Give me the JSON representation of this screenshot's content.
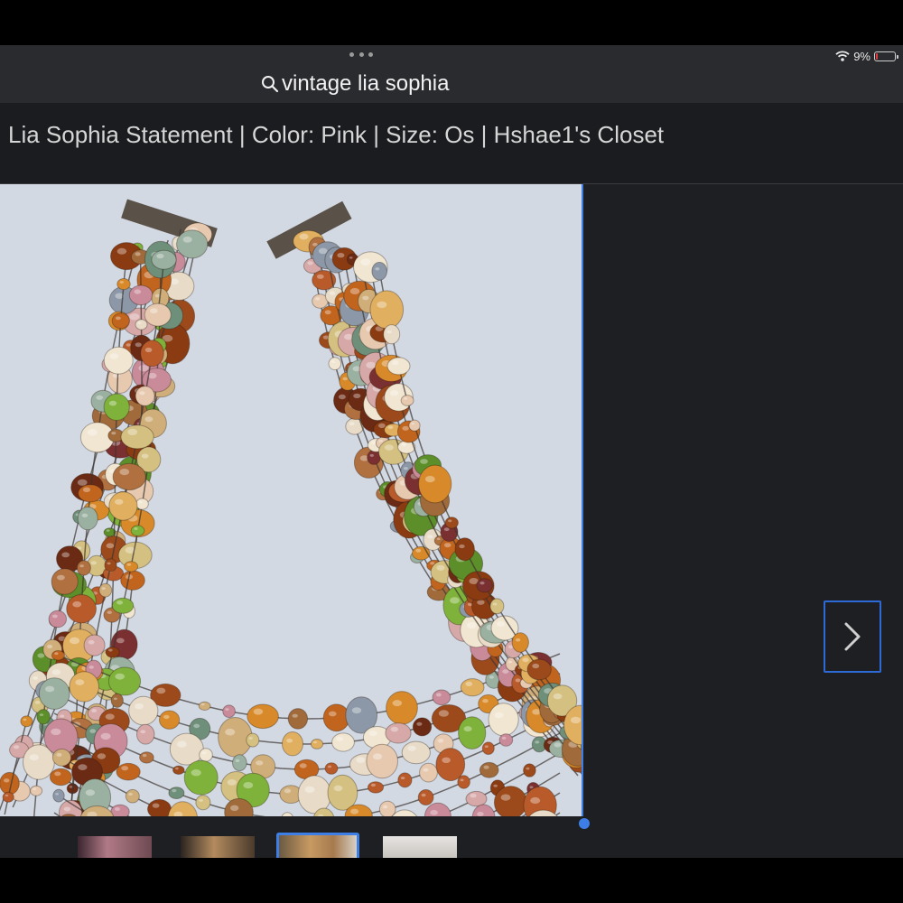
{
  "status_bar": {
    "battery_text": "9%",
    "battery_level": 0.09,
    "battery_color": "#e23b3b"
  },
  "search": {
    "query": "vintage lia sophia"
  },
  "page": {
    "title": "Lia Sophia Statement | Color: Pink | Size: Os | Hshae1's Closet"
  },
  "viewer": {
    "photo_subject": "multi-strand beaded necklace",
    "selected_thumbnail_index": 2,
    "thumbnail_count": 4
  },
  "colors": {
    "accent": "#3d7fe6",
    "background": "#1e1f22"
  },
  "icons": [
    "search-icon",
    "wifi-icon",
    "battery-icon",
    "chevron-right-icon",
    "more-dots-icon"
  ]
}
